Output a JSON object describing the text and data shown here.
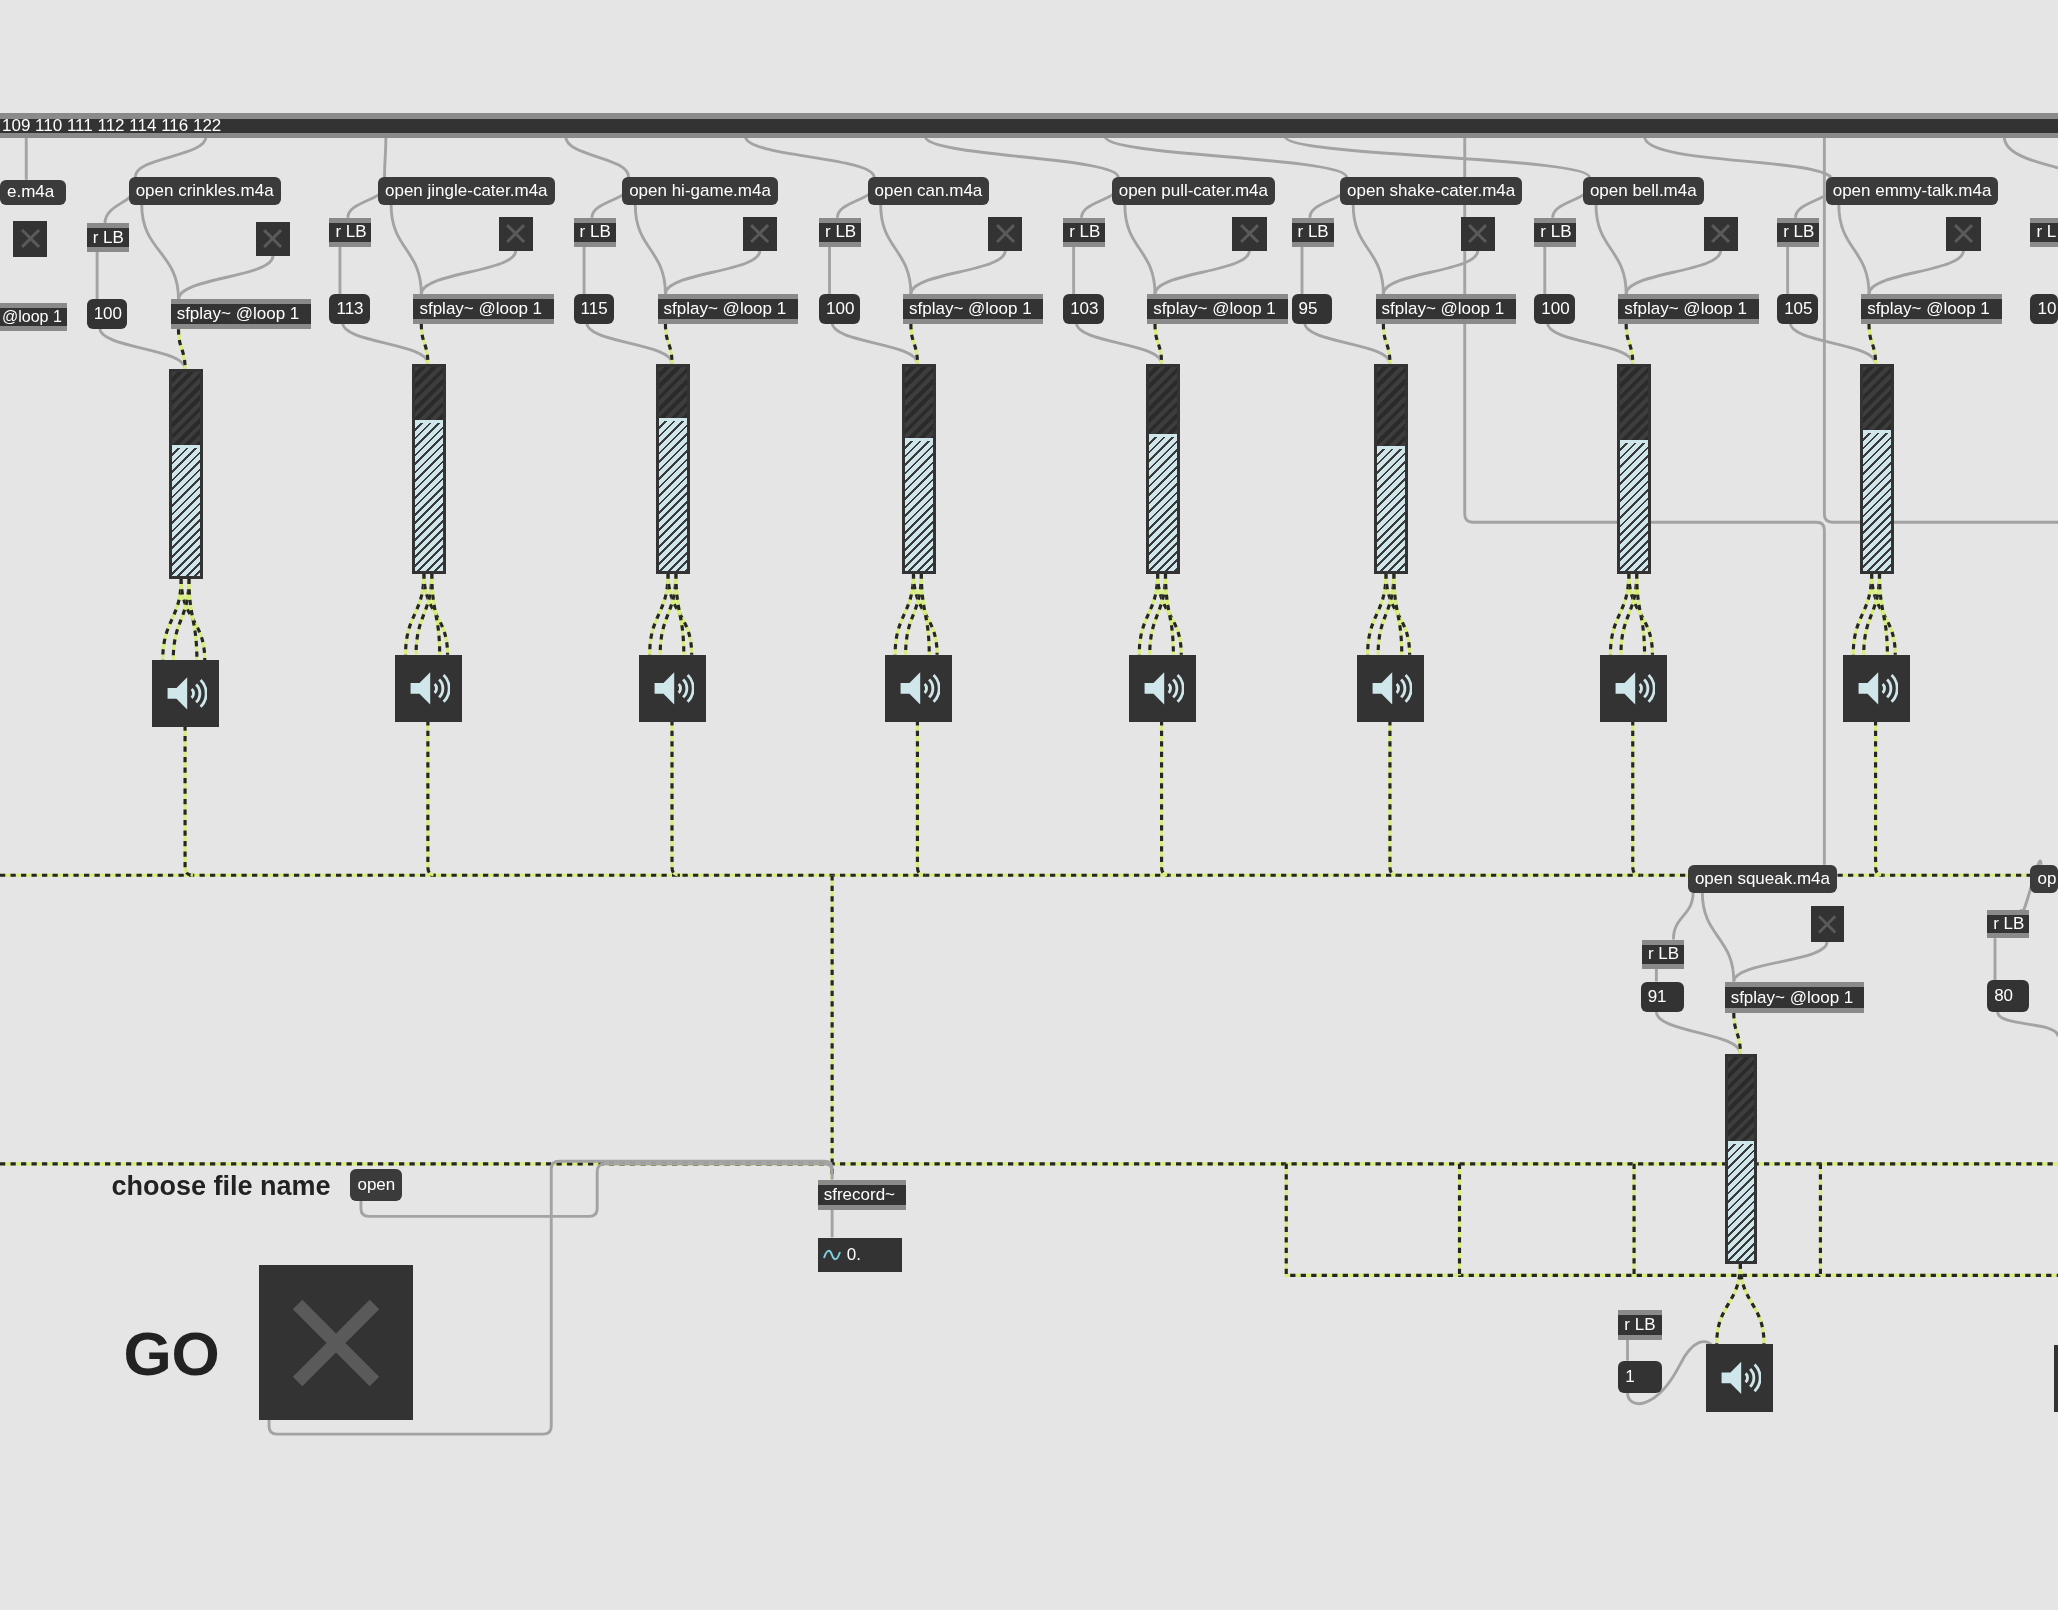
{
  "route_bar": {
    "text": "109 110 111 112 114 116 122"
  },
  "players": [
    {
      "message": "e.m4a",
      "toggle": {
        "on": false
      },
      "player": "@loop 1"
    },
    {
      "receive": "r LB",
      "number": "100",
      "message": "open crinkles.m4a",
      "toggle": {
        "on": false
      },
      "player": "sfplay~ @loop 1",
      "level": 0.64
    },
    {
      "receive": "r LB",
      "number": "113",
      "message": "open jingle-cater.m4a",
      "toggle": {
        "on": false
      },
      "player": "sfplay~ @loop 1",
      "level": 0.74
    },
    {
      "receive": "r LB",
      "number": "115",
      "message": "open hi-game.m4a",
      "toggle": {
        "on": false
      },
      "player": "sfplay~ @loop 1",
      "level": 0.75
    },
    {
      "receive": "r LB",
      "number": "100",
      "message": "open can.m4a",
      "toggle": {
        "on": false
      },
      "player": "sfplay~ @loop 1",
      "level": 0.65
    },
    {
      "receive": "r LB",
      "number": "103",
      "message": "open pull-cater.m4a",
      "toggle": {
        "on": false
      },
      "player": "sfplay~ @loop 1",
      "level": 0.67
    },
    {
      "receive": "r LB",
      "number": "95",
      "message": "open shake-cater.m4a",
      "toggle": {
        "on": false
      },
      "player": "sfplay~ @loop 1",
      "level": 0.61
    },
    {
      "receive": "r LB",
      "number": "100",
      "message": "open bell.m4a",
      "toggle": {
        "on": false
      },
      "player": "sfplay~ @loop 1",
      "level": 0.64
    },
    {
      "receive": "r LB",
      "number": "105",
      "message": "open emmy-talk.m4a",
      "toggle": {
        "on": false
      },
      "player": "sfplay~ @loop 1",
      "level": 0.69
    },
    {
      "receive": "r L",
      "number": "10"
    }
  ],
  "squeak": {
    "message": "open squeak.m4a",
    "toggle": {
      "on": false
    },
    "receive": "r LB",
    "number": "91",
    "player": "sfplay~ @loop 1",
    "level": 0.59
  },
  "right_group": {
    "message": "op",
    "receive": "r LB",
    "number": "80"
  },
  "output": {
    "receive": "r LB",
    "number": "1"
  },
  "recorder": {
    "label": "choose file name",
    "open_message": "open",
    "object": "sfrecord~",
    "time": "0.",
    "go_label": "GO",
    "go_toggle": {
      "on": false
    }
  }
}
